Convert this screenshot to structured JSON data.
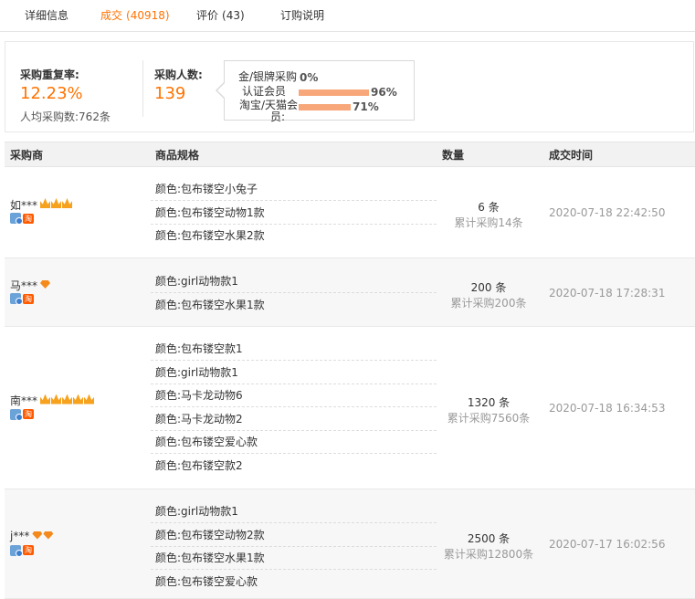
{
  "tabs": [
    {
      "label": "详细信息",
      "count": ""
    },
    {
      "label": "成交",
      "count": "(40918)"
    },
    {
      "label": "评价",
      "count": "(43)"
    },
    {
      "label": "订购说明",
      "count": ""
    }
  ],
  "stats": {
    "repeat_rate_label": "采购重复率:",
    "repeat_rate_value": "12.23%",
    "avg_label": "人均采购数:",
    "avg_value": "762条",
    "buyers_label": "采购人数:",
    "buyers_value": "139"
  },
  "tooltip": [
    {
      "label": "金/银牌采购",
      "label2": "",
      "percent": "0%",
      "fraction": 0.0
    },
    {
      "label": "认证会员",
      "label2": "",
      "percent": "96%",
      "fraction": 0.96
    },
    {
      "label": "淘宝/天猫会",
      "label2": "员:",
      "percent": "71%",
      "fraction": 0.71
    }
  ],
  "table": {
    "headers": [
      "采购商",
      "商品规格",
      "数量",
      "成交时间"
    ],
    "rows": [
      {
        "buyer": "如***",
        "crowns": 3,
        "diamonds": 0,
        "specs": [
          "颜色:包布镂空小兔子",
          "颜色:包布镂空动物1款",
          "颜色:包布镂空水果2款"
        ],
        "qty": "6 条",
        "total": "累计采购14条",
        "time": "2020-07-18 22:42:50"
      },
      {
        "buyer": "马***",
        "crowns": 0,
        "diamonds": 1,
        "specs": [
          "颜色:girl动物款1",
          "颜色:包布镂空水果1款"
        ],
        "qty": "200 条",
        "total": "累计采购200条",
        "time": "2020-07-18 17:28:31"
      },
      {
        "buyer": "南***",
        "crowns": 5,
        "diamonds": 0,
        "specs": [
          "颜色:包布镂空款1",
          "颜色:girl动物款1",
          "颜色:马卡龙动物6",
          "颜色:马卡龙动物2",
          "颜色:包布镂空爱心款",
          "颜色:包布镂空款2"
        ],
        "qty": "1320 条",
        "total": "累计采购7560条",
        "time": "2020-07-18 16:34:53"
      },
      {
        "buyer": "j***",
        "crowns": 0,
        "diamonds": 2,
        "specs": [
          "颜色:girl动物款1",
          "颜色:包布镂空动物2款",
          "颜色:包布镂空水果1款",
          "颜色:包布镂空爱心款"
        ],
        "qty": "2500 条",
        "total": "累计采购12800条",
        "time": "2020-07-17 16:02:56"
      }
    ]
  },
  "badges": {
    "tao": "淘"
  },
  "colors": {
    "accent": "#ff7300",
    "bar": "#f7a77a"
  }
}
